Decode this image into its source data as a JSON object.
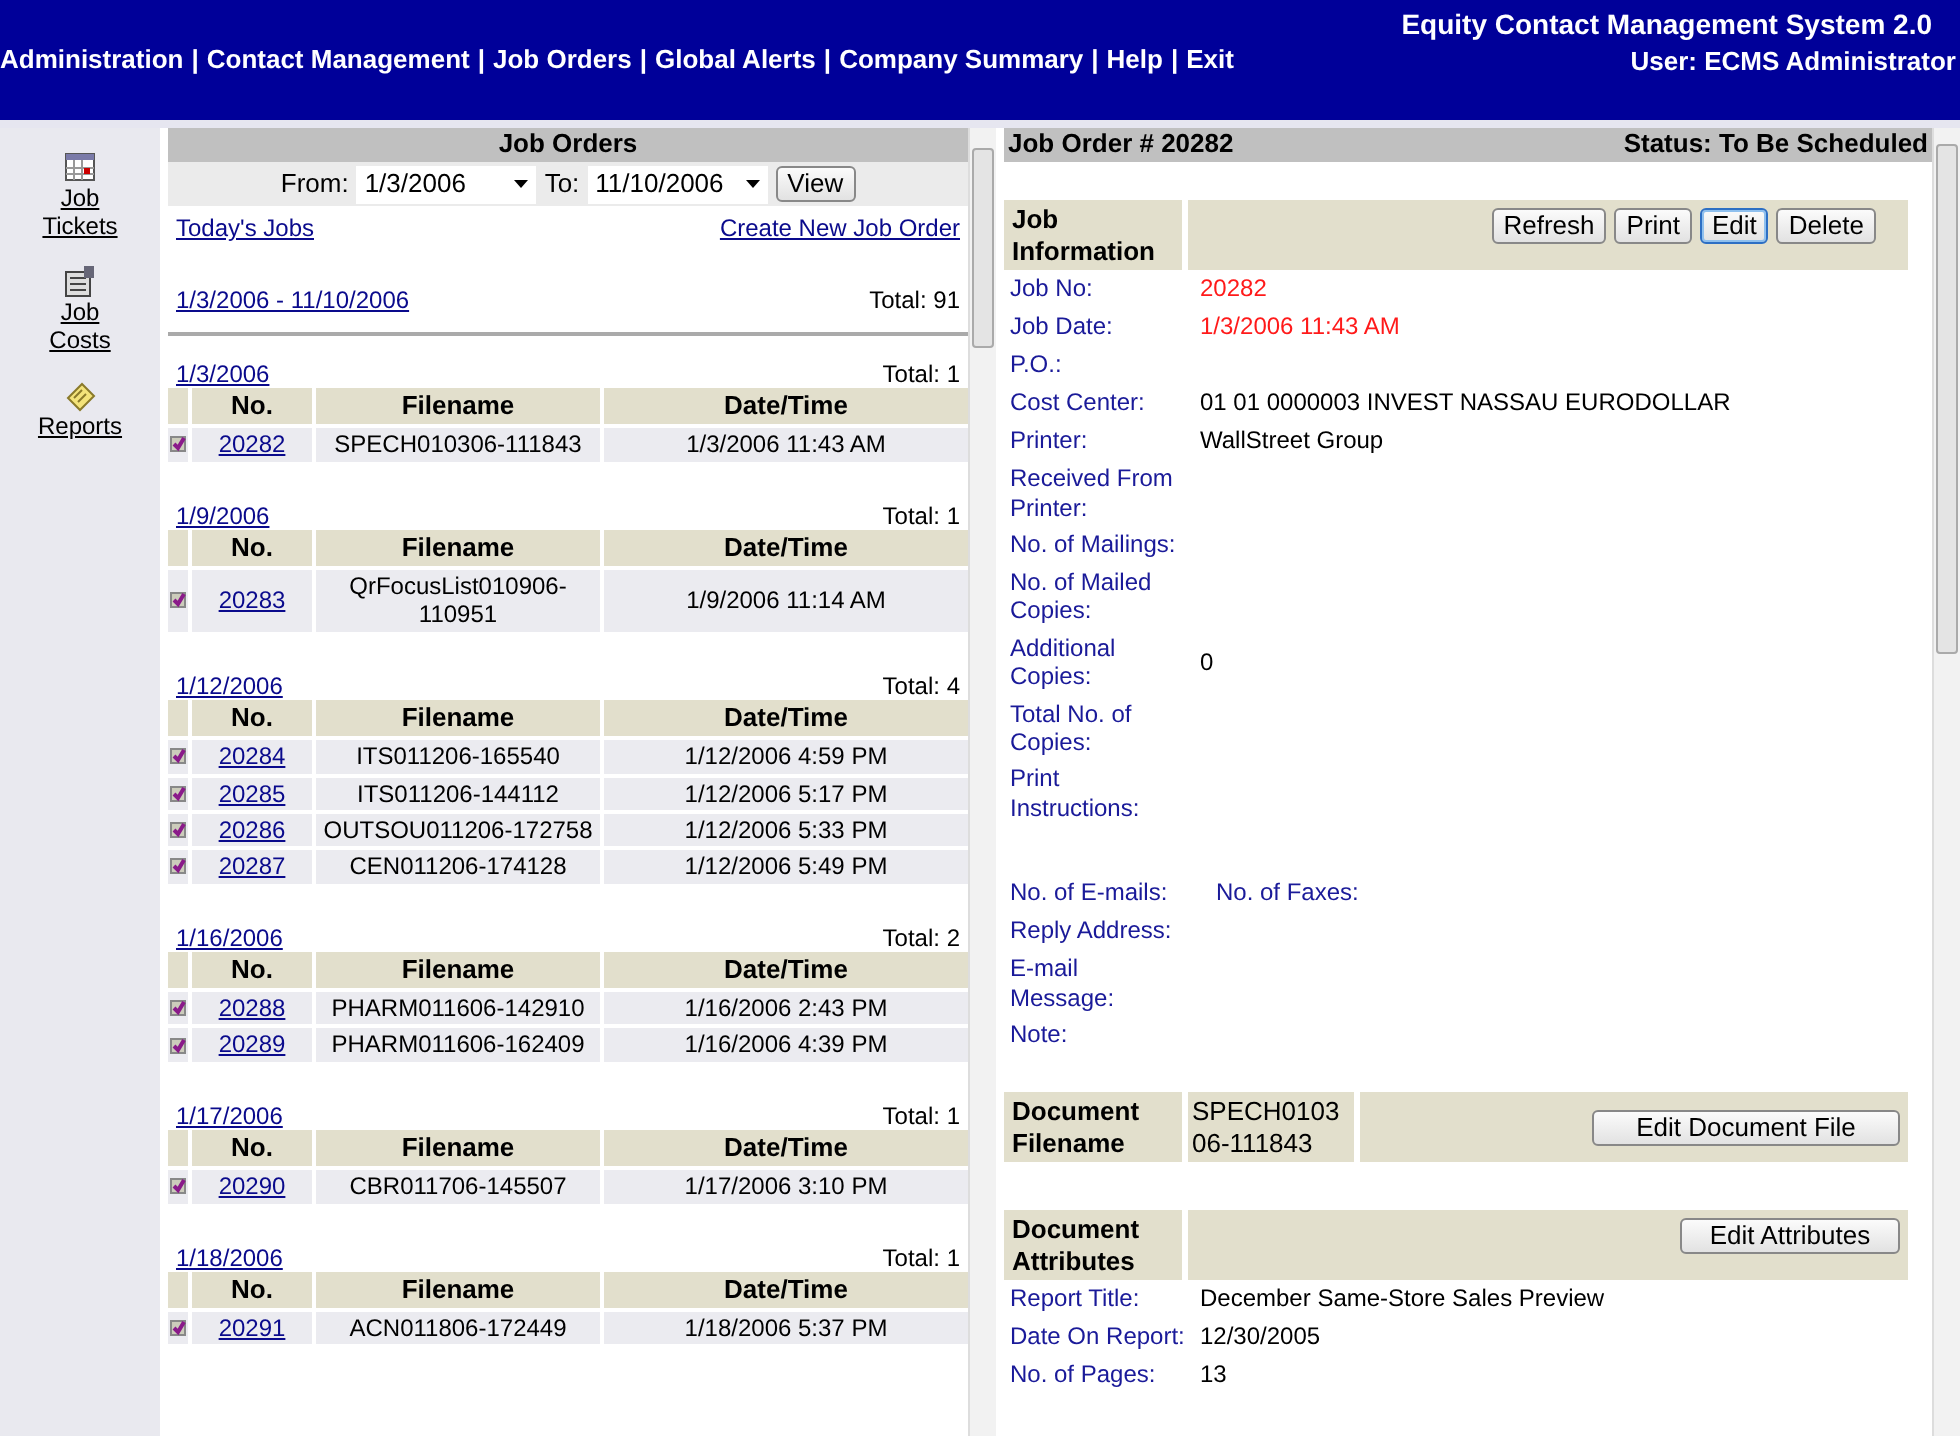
{
  "header": {
    "title": "Equity Contact Management System 2.0",
    "user": "User: ECMS Administrator",
    "separator": "|",
    "menu": [
      "Administration",
      "Contact Management",
      "Job Orders",
      "Global Alerts",
      "Company Summary",
      "Help",
      "Exit"
    ]
  },
  "sidebar": {
    "items": [
      {
        "kind": "calendar",
        "label": "Job Tickets"
      },
      {
        "kind": "ledger",
        "label": "Job Costs"
      },
      {
        "kind": "notepad",
        "label": "Reports"
      }
    ]
  },
  "job_orders": {
    "title": "Job Orders",
    "from_label": "From:",
    "from": "1/3/2006",
    "to_label": "To:",
    "to": "11/10/2006",
    "view_button": "View",
    "todays_jobs": "Today's Jobs",
    "create_link": "Create New Job Order",
    "range": "1/3/2006 - 11/10/2006",
    "range_total": "Total: 91",
    "groups": [
      {
        "date": "1/3/2006",
        "total": "Total: 1",
        "columns": [
          "No.",
          "Filename",
          "Date/Time"
        ],
        "rows": [
          {
            "no": "20282",
            "filename": "SPECH010306-111843",
            "datetime": "1/3/2006 11:43 AM"
          }
        ]
      },
      {
        "date": "1/9/2006",
        "total": "Total: 1",
        "columns": [
          "No.",
          "Filename",
          "Date/Time"
        ],
        "rows": [
          {
            "no": "20283",
            "filename": "QrFocusList010906-110951",
            "datetime": "1/9/2006 11:14 AM"
          }
        ]
      },
      {
        "date": "1/12/2006",
        "total": "Total: 4",
        "columns": [
          "No.",
          "Filename",
          "Date/Time"
        ],
        "rows": [
          {
            "no": "20284",
            "filename": "ITS011206-165540",
            "datetime": "1/12/2006 4:59 PM"
          },
          {
            "no": "20285",
            "filename": "ITS011206-144112",
            "datetime": "1/12/2006 5:17 PM"
          },
          {
            "no": "20286",
            "filename": "OUTSOU011206-172758",
            "datetime": "1/12/2006 5:33 PM"
          },
          {
            "no": "20287",
            "filename": "CEN011206-174128",
            "datetime": "1/12/2006 5:49 PM"
          }
        ]
      },
      {
        "date": "1/16/2006",
        "total": "Total: 2",
        "columns": [
          "No.",
          "Filename",
          "Date/Time"
        ],
        "rows": [
          {
            "no": "20288",
            "filename": "PHARM011606-142910",
            "datetime": "1/16/2006 2:43 PM"
          },
          {
            "no": "20289",
            "filename": "PHARM011606-162409",
            "datetime": "1/16/2006 4:39 PM"
          }
        ]
      },
      {
        "date": "1/17/2006",
        "total": "Total: 1",
        "columns": [
          "No.",
          "Filename",
          "Date/Time"
        ],
        "rows": [
          {
            "no": "20290",
            "filename": "CBR011706-145507",
            "datetime": "1/17/2006 3:10 PM"
          }
        ]
      },
      {
        "date": "1/18/2006",
        "total": "Total: 1",
        "columns": [
          "No.",
          "Filename",
          "Date/Time"
        ],
        "rows": [
          {
            "no": "20291",
            "filename": "ACN011806-172449",
            "datetime": "1/18/2006 5:37 PM"
          }
        ]
      }
    ]
  },
  "detail": {
    "title": "Job Order # 20282",
    "status": "Status: To Be Scheduled",
    "job_info": {
      "heading": "Job Information",
      "buttons": [
        {
          "label": "Refresh",
          "focused": false
        },
        {
          "label": "Print",
          "focused": false
        },
        {
          "label": "Edit",
          "focused": true
        },
        {
          "label": "Delete",
          "focused": false
        }
      ],
      "fields": [
        {
          "kind": "field",
          "label": "Job No:",
          "value": "20282",
          "emphasis": true
        },
        {
          "kind": "field",
          "label": "Job Date:",
          "value": "1/3/2006 11:43 AM",
          "emphasis": true
        },
        {
          "kind": "field",
          "label": "P.O.:"
        },
        {
          "kind": "field",
          "label": "Cost Center:",
          "value": "01 01 0000003 INVEST NASSAU EURODOLLAR",
          "emphasis": false
        },
        {
          "kind": "field",
          "label": "Printer:",
          "value": "WallStreet Group",
          "emphasis": false
        },
        {
          "kind": "field",
          "label": "Received From Printer:"
        },
        {
          "kind": "field",
          "label": "No. of Mailings:"
        },
        {
          "kind": "field",
          "label": "No. of Mailed Copies:"
        },
        {
          "kind": "field",
          "label": "Additional Copies:",
          "value": "0",
          "emphasis": false
        },
        {
          "kind": "field",
          "label": "Total No. of Copies:"
        },
        {
          "kind": "tall",
          "label": "Print Instructions:"
        },
        {
          "kind": "pair",
          "label": "No. of E-mails:",
          "label_2": "No. of Faxes:"
        },
        {
          "kind": "field",
          "label": "Reply Address:"
        },
        {
          "kind": "field",
          "label": "E-mail Message:"
        },
        {
          "kind": "field",
          "label": "Note:"
        }
      ]
    },
    "document_file": {
      "heading": "Document Filename",
      "value": "SPECH010306-111843",
      "button": "Edit Document File"
    },
    "document_attributes": {
      "heading": "Document Attributes",
      "button": "Edit Attributes",
      "fields": [
        {
          "label": "Report Title:",
          "value": "December Same-Store Sales Preview"
        },
        {
          "label": "Date On Report:",
          "value": "12/30/2005"
        },
        {
          "label": "No. of Pages:",
          "value": "13"
        }
      ]
    }
  }
}
